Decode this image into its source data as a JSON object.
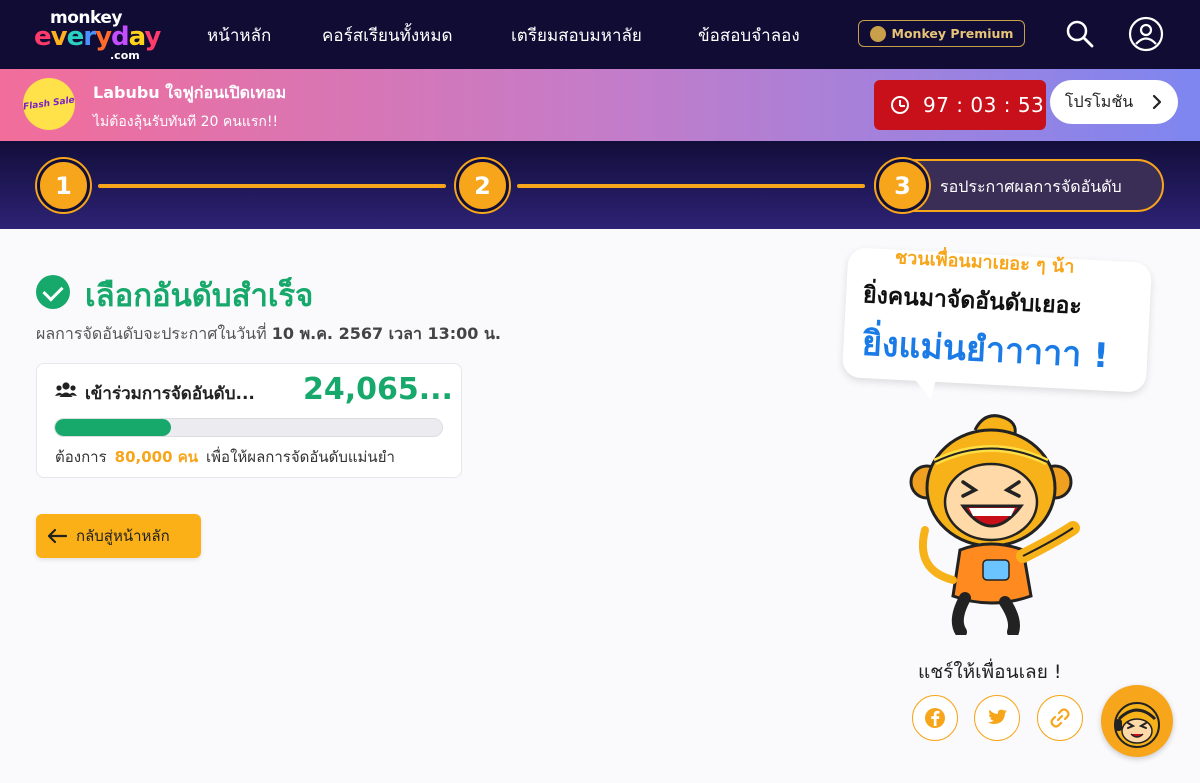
{
  "nav": {
    "logo_top": "monkey",
    "logo_main": "everyday",
    "logo_domain": ".com",
    "links": [
      "หน้าหลัก",
      "คอร์สเรียนทั้งหมด",
      "เตรียมสอบมหาลัย",
      "ข้อสอบจำลอง"
    ],
    "premium_label": "Monkey Premium"
  },
  "promo": {
    "badge": "Flash Sale",
    "title": "Labubu ใจฟูก่อนเปิดเทอม",
    "subtitle": "ไม่ต้องลุ้นรับทันที 20 คนแรก!!",
    "timer": {
      "hh": "97",
      "mm": "03",
      "ss": "53"
    },
    "button_label": "โปรโมชัน"
  },
  "stepper": {
    "step1": "1",
    "step2": "2",
    "step3": "3",
    "step3_label": "รอประกาศผลการจัดอันดับ"
  },
  "main": {
    "title": "เลือกอันดับสำเร็จ",
    "announce_prefix": "ผลการจัดอันดับจะประกาศในวันที่",
    "announce_date": "10 พ.ค. 2567 เวลา 13:00 น.",
    "participants_label": "เข้าร่วมการจัดอันดับ...",
    "participants_value": "24,065...",
    "progress_percent": 30,
    "need_prefix": "ต้องการ",
    "need_goal": "80,000 คน",
    "need_suffix": "เพื่อให้ผลการจัดอันดับแม่นยำ",
    "back_label": "กลับสู่หน้าหลัก"
  },
  "side": {
    "bubble_line1": "ชวนเพื่อนมาเยอะ ๆ น้า",
    "bubble_line2": "ยิ่งคนมาจัดอันดับเยอะ",
    "bubble_line3": "ยิ่งแม่นยำาาาา !",
    "share_label": "แชร์ให้เพื่อนเลย !"
  },
  "colors": {
    "nav_bg": "#100c34",
    "accent": "#f7a51a",
    "success": "#17a86b",
    "timer": "#c8101a",
    "blue": "#1a7be6"
  }
}
